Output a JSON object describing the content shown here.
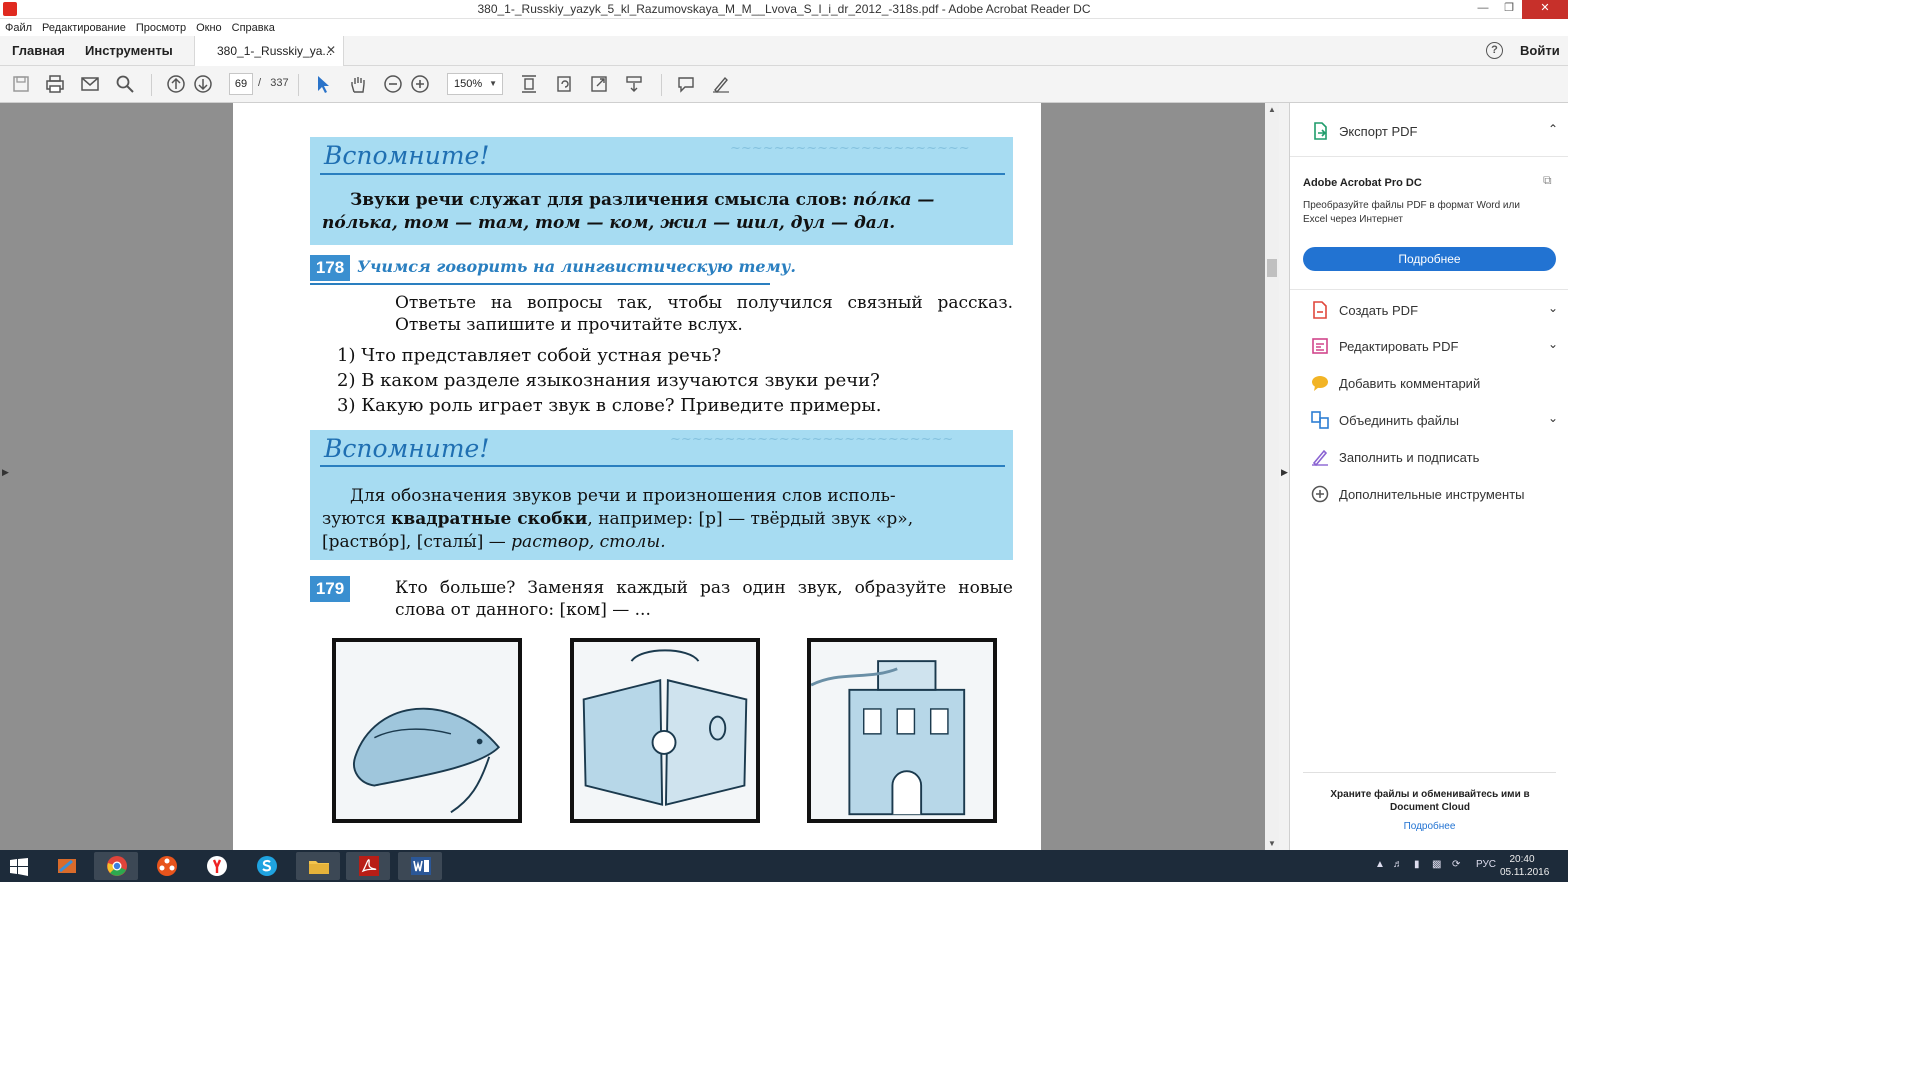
{
  "window": {
    "title": "380_1-_Russkiy_yazyk_5_kl_Razumovskaya_M_M__Lvova_S_I_i_dr_2012_-318s.pdf - Adobe Acrobat Reader DC"
  },
  "menu": [
    "Файл",
    "Редактирование",
    "Просмотр",
    "Окно",
    "Справка"
  ],
  "nav": {
    "home": "Главная",
    "tools": "Инструменты",
    "doc_tab": "380_1-_Russkiy_ya...",
    "signin": "Войти",
    "help": "?"
  },
  "toolbar": {
    "page_current": "69",
    "page_sep": "/",
    "page_total": "337",
    "zoom": "150%"
  },
  "page": {
    "rem1": {
      "heading": "Вспомните!",
      "text_bold": "Звуки речи служат для различения смысла слов:",
      "text_italic": "по́лка — по́лька, том — там, том — ком, жил — шил, дул — дал."
    },
    "ex178": {
      "num": "178",
      "heading": "Учимся говорить на лингвистическую тему.",
      "intro1": "Ответьте на вопросы так, чтобы получился связный рассказ.",
      "intro2": "Ответы запишите и прочитайте вслух.",
      "q1": "1) Что представляет собой устная речь?",
      "q2": "2) В каком разделе языкознания изучаются звуки речи?",
      "q3": "3) Какую роль играет звук в слове? Приведите примеры."
    },
    "rem2": {
      "heading": "Вспомните!",
      "line1": "Для обозначения звуков речи и произношения слов исполь-",
      "line2_a": "зуются ",
      "line2_b": "квадратные скобки",
      "line2_c": ", например: [р] — твёрдый звук «р»,",
      "line3_a": "[раство́р], [сталы́] — ",
      "line3_b": "раствор, столы."
    },
    "ex179": {
      "num": "179",
      "line1": "Кто больше? Заменяя каждый раз один звук, образуйте новые",
      "line2": "слова от данного: [ком] — ..."
    }
  },
  "right_panel": {
    "export": "Экспорт PDF",
    "promo_title": "Adobe Acrobat Pro DC",
    "promo_desc": "Преобразуйте файлы PDF в формат Word или Excel через Интернет",
    "promo_button": "Подробнее",
    "tools": [
      {
        "label": "Создать PDF",
        "icon": "create-pdf-icon",
        "color": "#e0473c"
      },
      {
        "label": "Редактировать PDF",
        "icon": "edit-pdf-icon",
        "color": "#d1468c"
      },
      {
        "label": "Добавить комментарий",
        "icon": "comment-icon",
        "color": "#f2b425"
      },
      {
        "label": "Объединить файлы",
        "icon": "combine-files-icon",
        "color": "#2e7ed3"
      },
      {
        "label": "Заполнить и подписать",
        "icon": "fill-sign-icon",
        "color": "#8a63d2"
      },
      {
        "label": "Дополнительные инструменты",
        "icon": "more-tools-icon",
        "color": "#555555"
      }
    ],
    "footer_text": "Храните файлы и обменивайтесь ими в Document Cloud",
    "footer_link": "Подробнее"
  },
  "taskbar": {
    "lang": "РУС",
    "time": "20:40",
    "date": "05.11.2016"
  }
}
